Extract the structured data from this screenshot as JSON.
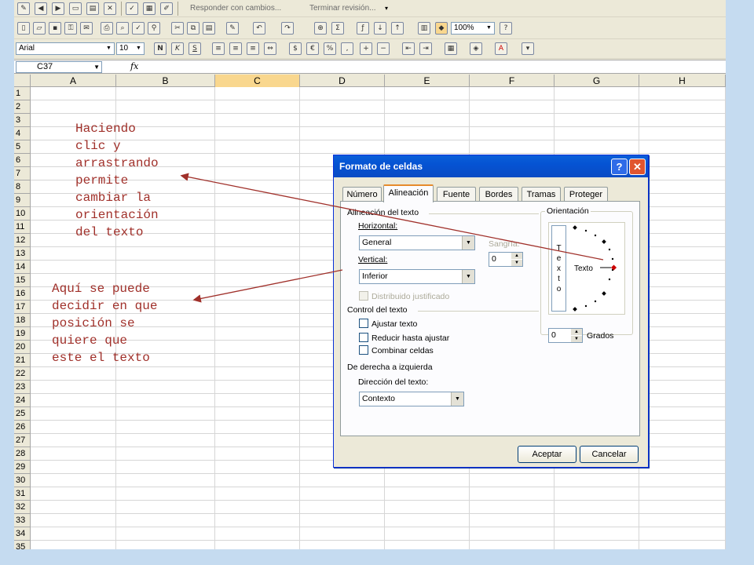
{
  "toolbar_review": {
    "reply_label": "Responder con cambios...",
    "end_review_label": "Terminar revisión..."
  },
  "toolbar_standard": {
    "zoom": "100%"
  },
  "toolbar_format": {
    "font": "Arial",
    "size": "10",
    "bold": "N",
    "italic": "K",
    "underline": "S"
  },
  "formula_bar": {
    "name_box": "C37",
    "fx": "fx"
  },
  "sheet": {
    "columns": [
      "A",
      "B",
      "C",
      "D",
      "E",
      "F",
      "G",
      "H"
    ],
    "selected_column": "C",
    "rows": [
      "1",
      "2",
      "3",
      "4",
      "5",
      "6",
      "7",
      "8",
      "9",
      "10",
      "11",
      "12",
      "13",
      "14",
      "15",
      "16",
      "17",
      "18",
      "19",
      "20",
      "21",
      "22",
      "23",
      "24",
      "25",
      "26",
      "27",
      "28",
      "29",
      "30",
      "31",
      "32",
      "33",
      "34",
      "35"
    ]
  },
  "annotations": {
    "drag_note": "Haciendo\nclic y\narrastrando\npermite\ncambiar la\norientación\ndel texto",
    "position_note": "Aquí se puede\ndecidir en que\nposición se\nquiere que\neste el texto"
  },
  "dialog": {
    "title": "Formato de celdas",
    "help": "?",
    "close": "✕",
    "tabs": [
      "Número",
      "Alineación",
      "Fuente",
      "Bordes",
      "Tramas",
      "Proteger"
    ],
    "active_tab": "Alineación",
    "alignment_group": "Alineación del texto",
    "horizontal_label": "Horizontal:",
    "horizontal_value": "General",
    "indent_label": "Sangría:",
    "indent_value": "0",
    "vertical_label": "Vertical:",
    "vertical_value": "Inferior",
    "justify_distributed": "Distribuido justificado",
    "text_control_group": "Control del texto",
    "wrap_text": "Ajustar texto",
    "shrink_to_fit": "Reducir hasta ajustar",
    "merge_cells": "Combinar celdas",
    "rtl_group": "De derecha a izquierda",
    "direction_label": "Dirección del texto:",
    "direction_value": "Contexto",
    "orientation_group": "Orientación",
    "vertical_text": "T e x t o",
    "dial_text": "Texto",
    "degrees_value": "0",
    "degrees_label": "Grados",
    "ok": "Aceptar",
    "cancel": "Cancelar"
  },
  "colors": {
    "annotation": "#a0302a",
    "title_bar": "#0553d3",
    "selected_column": "#f9d78e"
  }
}
